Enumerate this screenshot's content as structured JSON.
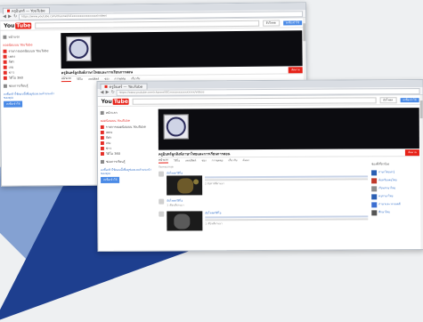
{
  "browser": {
    "tab_title": "ครูอินทร์ — YouTube",
    "address": "https://www.youtube.com/channel/UCxxxxxxxxxxxxxxxx/videos",
    "nav_back": "◀",
    "nav_forward": "▶",
    "nav_reload": "↻"
  },
  "youtube": {
    "logo_you": "You",
    "logo_tube": "Tube",
    "upload_label": "อัปโหลด",
    "signin_label": "ลงชื่อเข้าใช้"
  },
  "sidebar": {
    "home": "หน้าแรก",
    "heading": "ยอดนิยมบน YouTube",
    "items": [
      {
        "label": "รายการยอดนิยมบน YouTube"
      },
      {
        "label": "เพลง"
      },
      {
        "label": "กีฬา"
      },
      {
        "label": "เกม"
      },
      {
        "label": "ข่าว"
      },
      {
        "label": "วิดีโอ 360"
      }
    ],
    "browse": "ช่องการเรียนรู้",
    "promo": "ลงชื่อเข้าใช้ตอนนี้เพื่อดูช่องและคำแนะนำของคุณ",
    "promo_button": "ลงชื่อเข้าใช้"
  },
  "channel": {
    "name": "ครูอินทร์ลูกสิงห์ภาษาไทยและการเรียนการสอน",
    "subscribe": "ติดตาม",
    "tabs": [
      "หน้าแรก",
      "วิดีโอ",
      "เพลย์ลิสต์",
      "ช่อง",
      "การพูดคุย",
      "เกี่ยวกับ",
      "ค้นหา"
    ]
  },
  "feed": {
    "label": "กิจกรรมล่าสุด",
    "items": [
      {
        "title": "อัปโหลดวิดีโอ",
        "meta": "2 สัปดาห์ที่ผ่านมา"
      },
      {
        "title": "อัปโหลดวิดีโอ",
        "meta": "1 เดือนที่ผ่านมา"
      },
      {
        "title": "อัปโหลดวิดีโอ",
        "meta": "1 เดือนที่ผ่านมา"
      }
    ]
  },
  "related": {
    "heading": "ช่องที่เกี่ยวข้อง",
    "items": [
      {
        "label": "ภาษาไทยน่ารู้",
        "color": "#2b5fb3"
      },
      {
        "label": "ห้องเรียนครูไทย",
        "color": "#c0392b"
      },
      {
        "label": "เรียนภาษาไทย",
        "color": "#8e8e8e"
      },
      {
        "label": "ครูภาษาไทย",
        "color": "#2b5fb3"
      },
      {
        "label": "ภาษาและวรรณคดี",
        "color": "#3c6fd1"
      },
      {
        "label": "ศึกษาไทย",
        "color": "#555555"
      }
    ]
  },
  "colors": {
    "youtube_red": "#e62117",
    "backdrop_blue": "#1e3f8f",
    "banner": "#0c0c10"
  }
}
